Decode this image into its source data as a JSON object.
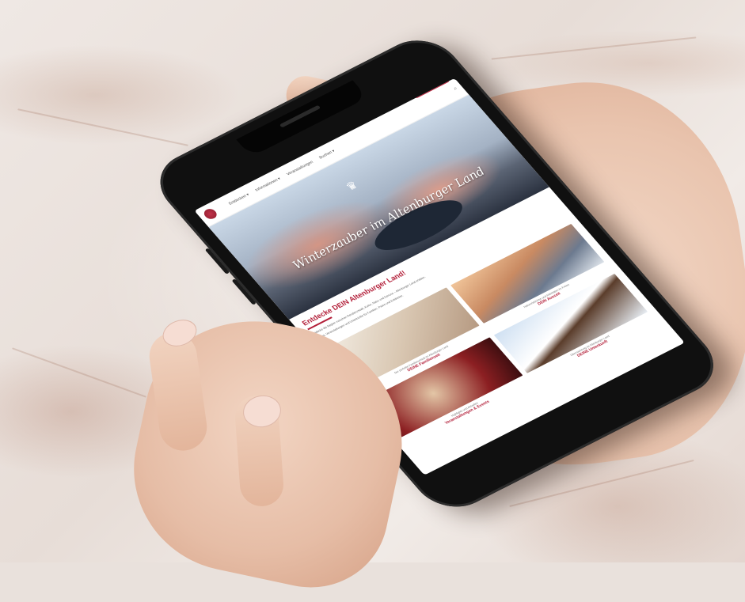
{
  "site": {
    "pill_label": "Ticketshop Ostthüringen",
    "nav": [
      {
        "label": "Entdecken"
      },
      {
        "label": "Informationen"
      },
      {
        "label": "Veranstaltungen"
      },
      {
        "label": "Buchen"
      }
    ],
    "search_icon": "⌕",
    "hero": {
      "title": "Winterzauber im Altenburger Land"
    },
    "intro": {
      "heading": "Entdecke DEIN Altenburger Land!",
      "paragraphs": [
        "Entdecke die Region zwischen Residenzstadt, Kultur, Natur und Genuss – Altenburger Land erleben.",
        "Freizeit, Veranstaltungen und Unterkünfte für Familien, Paare und Entdecker."
      ]
    },
    "cards": [
      {
        "sub": "Der perfekte Familienurlaub im Altenburger Land",
        "title": "DEINE Familienzeit",
        "thumb": "t-family"
      },
      {
        "sub": "Naturerlebnisse und Aktivitäten im Freien",
        "title": "DEIN Auszeit",
        "thumb": "t-out"
      },
      {
        "sub": "Highlights und Aktuelles",
        "title": "Veranstaltungen & Events",
        "thumb": "t-events"
      },
      {
        "sub": "Übernachtung im Altenburger Land",
        "title": "DEINE Unterkunft",
        "thumb": "t-stay"
      }
    ]
  },
  "colors": {
    "accent": "#b3203a",
    "phone": "#101010"
  }
}
